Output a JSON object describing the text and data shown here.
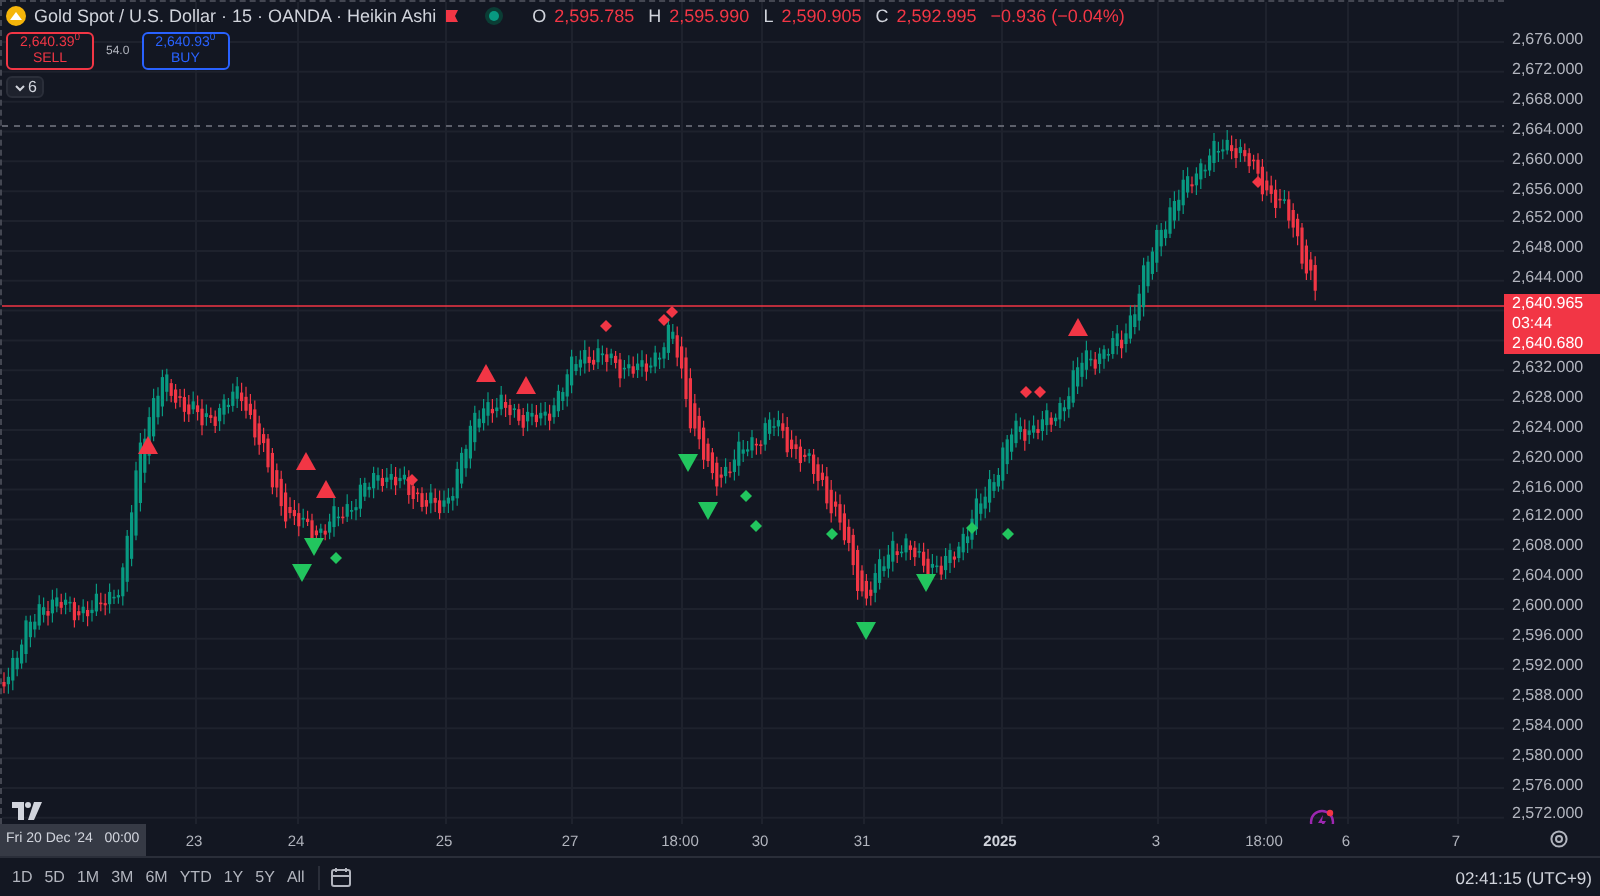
{
  "legend": {
    "title": "Gold Spot / U.S. Dollar · 15 · OANDA · Heikin Ashi",
    "market_open": true,
    "ohlc": [
      {
        "key": "O",
        "value": "2,595.785"
      },
      {
        "key": "H",
        "value": "2,595.990"
      },
      {
        "key": "L",
        "value": "2,590.905"
      },
      {
        "key": "C",
        "value": "2,592.995"
      }
    ],
    "change": "−0.936 (−0.04%)",
    "sell": {
      "price": "2,640.39$^{0}$",
      "label": "SELL"
    },
    "spread": "54.0",
    "buy": {
      "price": "2,640.93$^{0}$",
      "label": "BUY"
    },
    "indicators_toggle": "6"
  },
  "price_axis": {
    "labels_above": [
      "2,676.000",
      "2,672.000",
      "2,668.000",
      "2,664.000",
      "2,660.000",
      "2,656.000",
      "2,652.000",
      "2,648.000",
      "2,644.000"
    ],
    "current_price_tag": {
      "bid": "2,640.965",
      "countdown": "03:44",
      "ask": "2,640.680"
    },
    "labels_below": [
      "2,632.000",
      "2,628.000",
      "2,624.000",
      "2,620.000",
      "2,616.000",
      "2,612.000",
      "2,608.000",
      "2,604.000",
      "2,600.000",
      "2,596.000",
      "2,592.000",
      "2,588.000",
      "2,584.000",
      "2,580.000",
      "2,576.000",
      "2,572.000"
    ]
  },
  "time_axis": {
    "crosshair_label": "Fri 20 Dec '24   00:00",
    "labels": [
      {
        "text": "23",
        "bold": false
      },
      {
        "text": "24",
        "bold": false
      },
      {
        "text": "25",
        "bold": false
      },
      {
        "text": "27",
        "bold": false
      },
      {
        "text": "18:00",
        "bold": false
      },
      {
        "text": "30",
        "bold": false
      },
      {
        "text": "31",
        "bold": false
      },
      {
        "text": "2025",
        "bold": true
      },
      {
        "text": "3",
        "bold": false
      },
      {
        "text": "18:00",
        "bold": false
      },
      {
        "text": "6",
        "bold": false
      },
      {
        "text": "7",
        "bold": false
      }
    ]
  },
  "bottom_toolbar": {
    "ranges": [
      "1D",
      "5D",
      "1M",
      "3M",
      "6M",
      "YTD",
      "1Y",
      "5Y",
      "All"
    ],
    "clock": "02:41:15 (UTC+9)"
  }
}
